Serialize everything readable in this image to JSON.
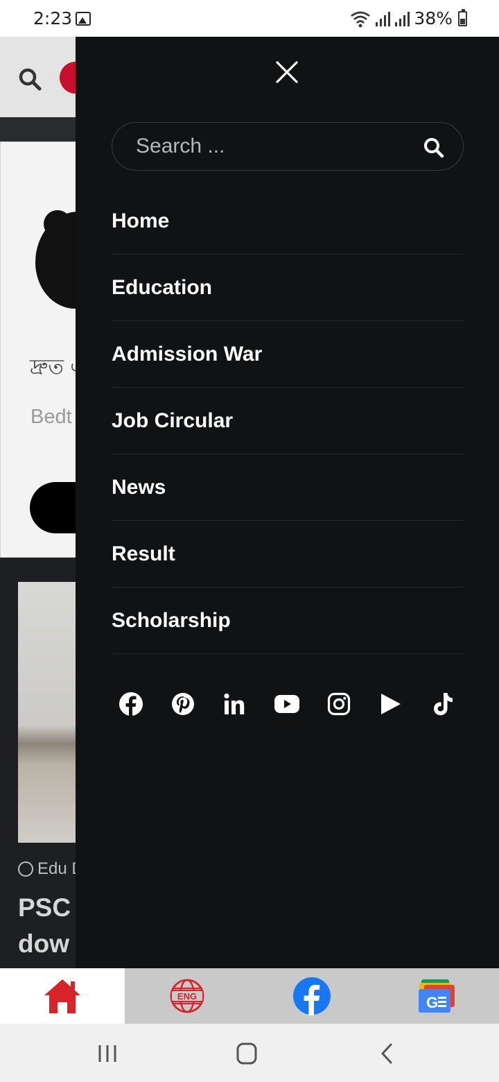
{
  "status_bar": {
    "time": "2:23",
    "battery": "38%",
    "icons": [
      "image-icon",
      "wifi-icon",
      "signal-icon",
      "signal-icon",
      "battery-icon"
    ]
  },
  "background_page": {
    "bengali_text": "দ্রুত এ",
    "card_subtitle": "Bedt",
    "post_author": "Edu D",
    "post_title_lines": [
      "PSC",
      "dow"
    ]
  },
  "drawer": {
    "search": {
      "placeholder": "Search ..."
    },
    "menu": [
      {
        "label": "Home"
      },
      {
        "label": "Education"
      },
      {
        "label": "Admission War"
      },
      {
        "label": "Job Circular"
      },
      {
        "label": "News"
      },
      {
        "label": "Result"
      },
      {
        "label": "Scholarship"
      }
    ],
    "social": [
      "facebook-icon",
      "pinterest-icon",
      "linkedin-icon",
      "youtube-icon",
      "instagram-icon",
      "play-icon",
      "tiktok-icon"
    ]
  },
  "bottom_nav": {
    "tabs": [
      {
        "icon": "home-icon",
        "active": true
      },
      {
        "icon": "english-globe-icon",
        "label": "ENG"
      },
      {
        "icon": "facebook-icon"
      },
      {
        "icon": "google-news-icon",
        "label": "G"
      }
    ]
  },
  "colors": {
    "drawer_bg": "#111214",
    "accent_red": "#d8232a",
    "facebook_blue": "#1877f2"
  }
}
